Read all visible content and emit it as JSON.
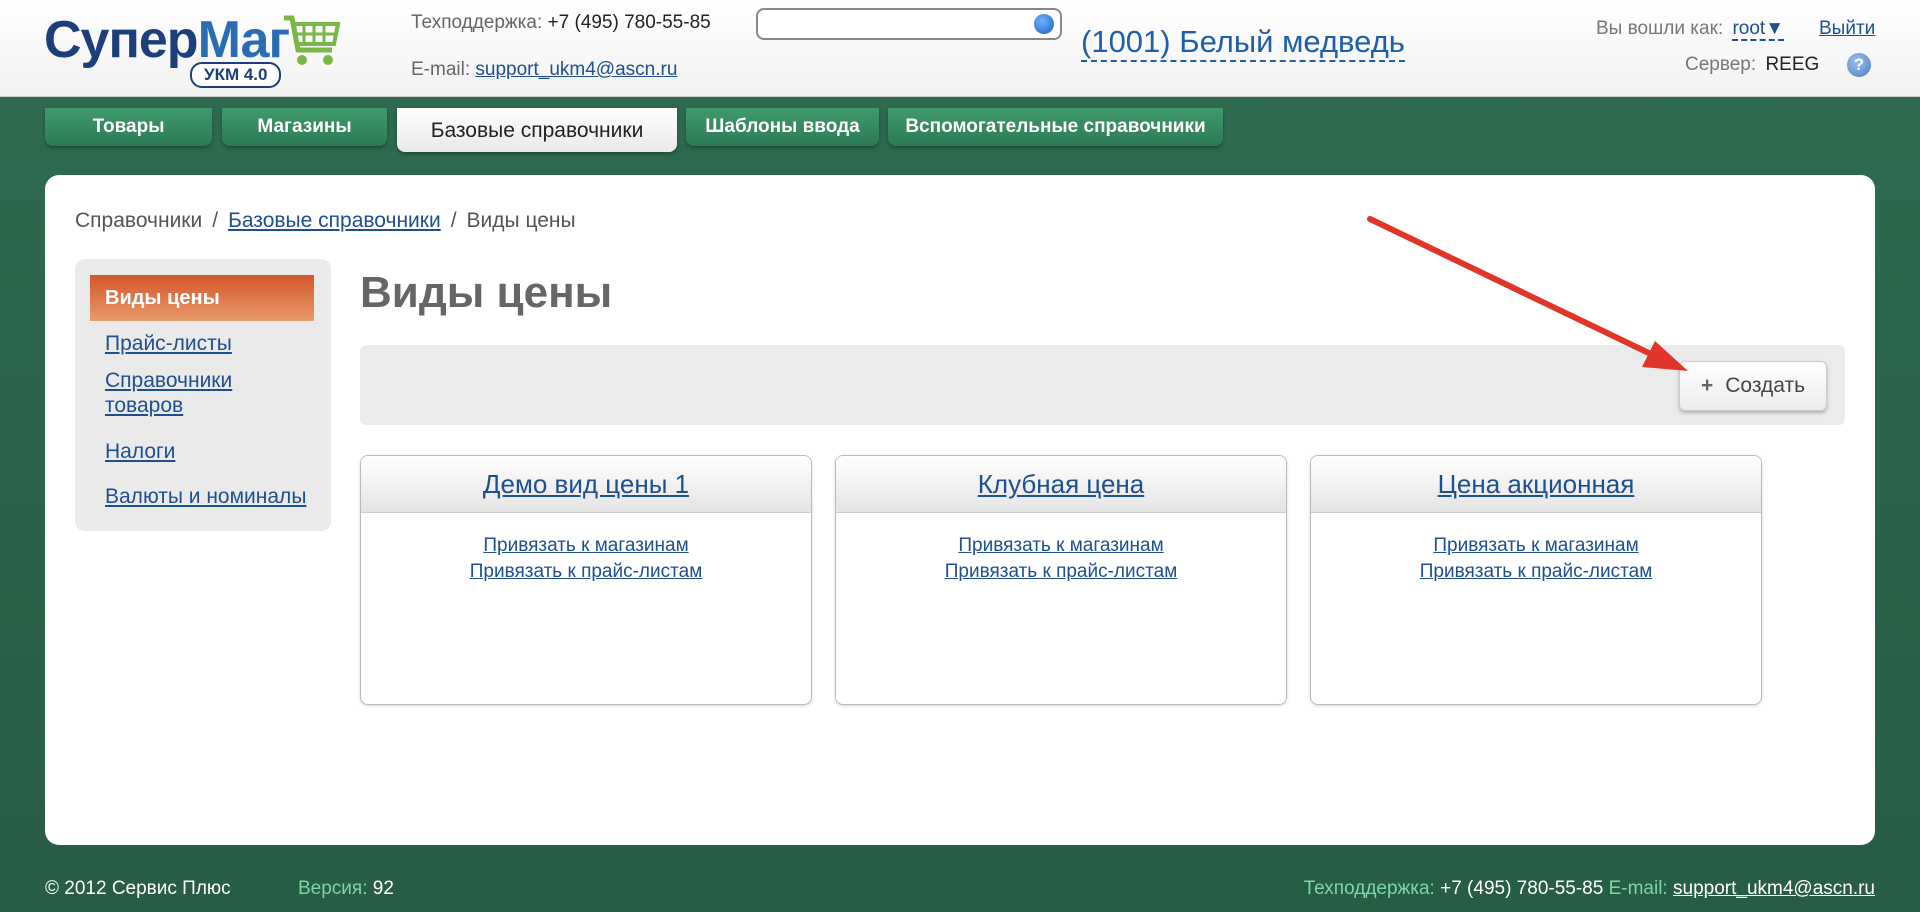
{
  "header": {
    "logo": {
      "part1": "Супер",
      "part2": "Маг",
      "badge": "УКМ 4.0"
    },
    "support_label": "Техподдержка:",
    "support_phone": "+7 (495) 780-55-85",
    "email_label": "E-mail:",
    "email": "support_ukm4@ascn.ru",
    "search": {
      "value": "",
      "placeholder": ""
    },
    "shop_title": "(1001) Белый медведь",
    "login_label": "Вы вошли как:",
    "user": "root",
    "user_arrow": "▼",
    "logout": "Выйти",
    "server_label": "Сервер:",
    "server": "REEG",
    "help": "?"
  },
  "tabs": [
    {
      "label": "Товары"
    },
    {
      "label": "Магазины"
    },
    {
      "label": "Базовые справочники",
      "active": true
    },
    {
      "label": "Шаблоны ввода"
    },
    {
      "label": "Вспомогательные справочники"
    }
  ],
  "breadcrumb": {
    "root": "Справочники",
    "sep": "/",
    "middle": "Базовые справочники",
    "current": "Виды цены"
  },
  "sidebar": {
    "active": "Виды цены",
    "items": [
      {
        "label": "Прайс-листы"
      },
      {
        "label": "Справочники товаров"
      },
      {
        "label": "Налоги"
      },
      {
        "label": "Валюты и номиналы"
      }
    ]
  },
  "main": {
    "title": "Виды цены",
    "create_label": "Создать",
    "create_icon": "+",
    "cards": [
      {
        "title": "Демо вид цены 1",
        "link1": "Привязать к магазинам",
        "link2": "Привязать к прайс-листам"
      },
      {
        "title": "Клубная цена",
        "link1": "Привязать к магазинам",
        "link2": "Привязать к прайс-листам"
      },
      {
        "title": "Цена акционная",
        "link1": "Привязать к магазинам",
        "link2": "Привязать к прайс-листам"
      }
    ]
  },
  "footer": {
    "copyright": "© 2012 Сервис Плюс",
    "version_label": "Версия:",
    "version": "92",
    "support_label": "Техподдержка:",
    "support_phone": "+7 (495) 780-55-85",
    "email_label": "E-mail:",
    "email": "support_ukm4@ascn.ru"
  },
  "colors": {
    "background": "#2d6a4f",
    "tab": "#3f9a6d",
    "active_sidebar": "#d3562a",
    "link": "#1e4f8f",
    "arrow": "#e2352a"
  }
}
